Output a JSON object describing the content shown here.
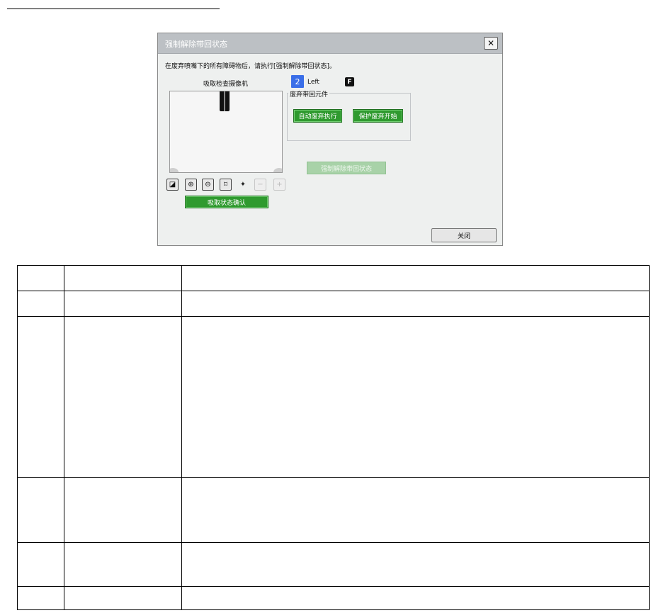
{
  "dialog": {
    "title": "强制解除带回状态",
    "close_symbol": "✕",
    "instruction": "在废弃喷嘴下的所有障碍物后，请执行[强制解除带回状态]。",
    "camera_label": "吸取检查摄像机",
    "nozzle": {
      "number": "2",
      "side": "Left",
      "flag": "F"
    },
    "group_title": "废弃带回元件",
    "buttons": {
      "auto_discard": "自动废弃执行",
      "protect_discard": "保护废弃开始",
      "force_release": "强制解除带回状态",
      "confirm_pickup": "吸取状态确认",
      "close": "关闭"
    },
    "toolbar_icons": [
      "image-save-icon",
      "zoom-in-icon",
      "zoom-out-icon",
      "fit-icon",
      "light-icon",
      "minus-icon",
      "plus-icon"
    ],
    "toolbar_glyphs": {
      "save": "◪",
      "zoom_in": "⊕",
      "zoom_out": "⊖",
      "fit": "⌑",
      "light": "✦",
      "minus": "−",
      "plus": "+"
    },
    "colors": {
      "accent_green": "#2f9a2f",
      "badge_blue": "#3a6ee8",
      "titlebar": "#bcc0c4"
    }
  },
  "table": {
    "rows": [
      [
        "",
        "",
        ""
      ],
      [
        "",
        "",
        ""
      ],
      [
        "",
        "",
        ""
      ],
      [
        "",
        "",
        ""
      ],
      [
        "",
        "",
        ""
      ],
      [
        "",
        "",
        ""
      ]
    ]
  }
}
